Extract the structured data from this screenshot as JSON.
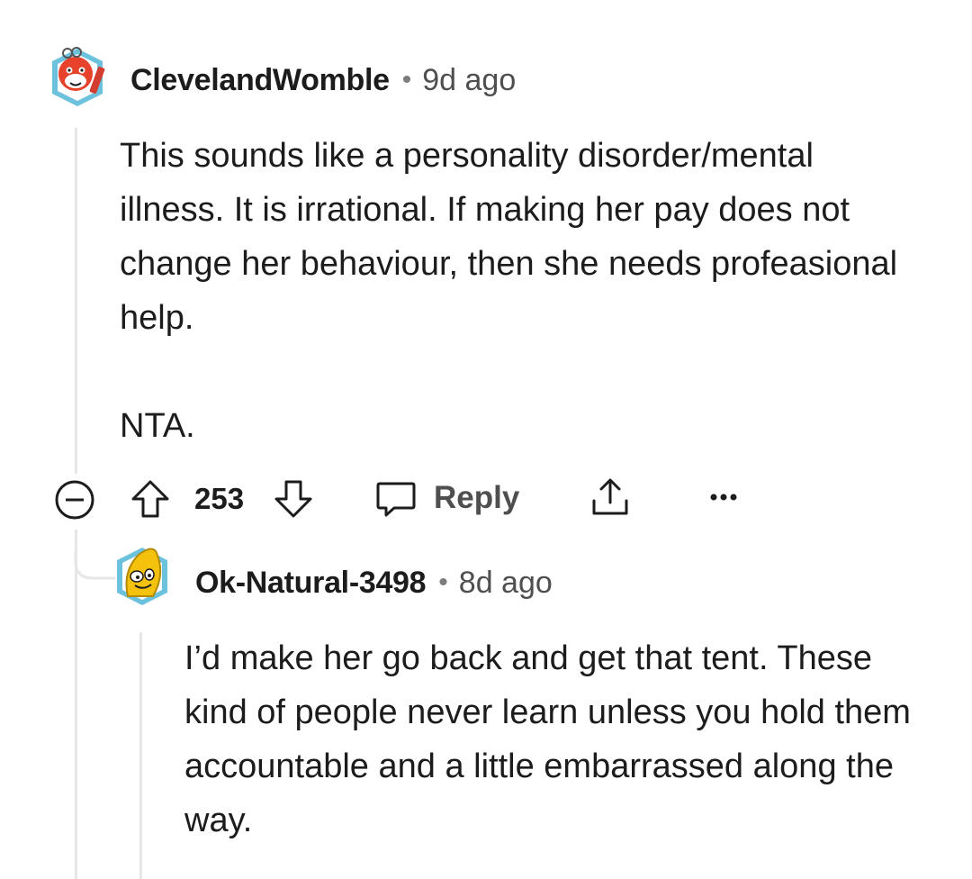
{
  "comments": [
    {
      "username": "ClevelandWomble",
      "separator": "•",
      "time": "9d ago",
      "paragraphs": [
        "This sounds like a personality disorder/mental illness. It is irrational. If making her pay does not change her behaviour, then she needs profeasional help.",
        "NTA."
      ],
      "votes": "253",
      "reply_label": "Reply"
    },
    {
      "username": "Ok-Natural-3498",
      "separator": "•",
      "time": "8d ago",
      "paragraphs": [
        "I’d make her go back and get that tent. These kind of people never learn unless you hold them accountable and a little embarrassed along the way."
      ]
    }
  ],
  "icons": {
    "collapse": "minus-circle-icon",
    "upvote": "upvote-arrow-icon",
    "downvote": "downvote-arrow-icon",
    "reply": "speech-bubble-icon",
    "share": "share-icon",
    "more": "more-dots-icon"
  },
  "colors": {
    "thread_line": "#e6e6e6",
    "icon_gray": "#1c1c1c",
    "text_secondary": "#4f4f4f"
  }
}
